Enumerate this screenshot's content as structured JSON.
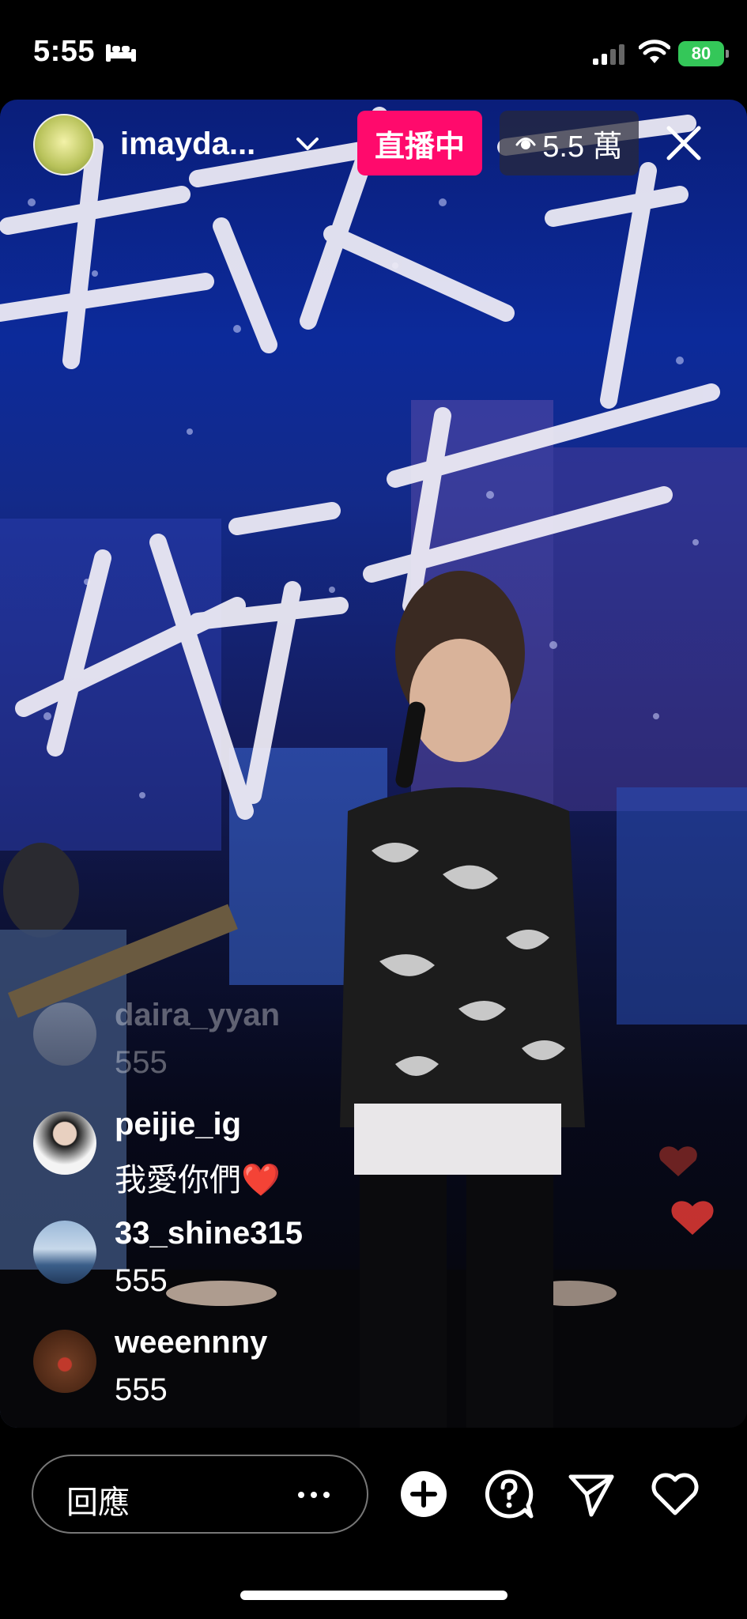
{
  "status_bar": {
    "time": "5:55",
    "battery": "80"
  },
  "live": {
    "host_name": "imayda...",
    "live_label": "直播中",
    "viewer_count": "5.5 萬"
  },
  "comments": [
    {
      "user": "daira_yyan",
      "text": "555"
    },
    {
      "user": "peijie_ig",
      "text": "我愛你們❤️"
    },
    {
      "user": "33_shine315",
      "text": "555"
    },
    {
      "user": "weeennny",
      "text": "555"
    }
  ],
  "bottom_bar": {
    "reply_placeholder": "回應"
  },
  "colors": {
    "live_badge": "#ff0a6c",
    "battery": "#34c759"
  },
  "icons": [
    "bed-icon",
    "signal-icon",
    "wifi-icon",
    "chevron-down-icon",
    "eye-icon",
    "close-icon",
    "more-icon",
    "add-icon",
    "question-icon",
    "send-icon",
    "heart-icon"
  ]
}
